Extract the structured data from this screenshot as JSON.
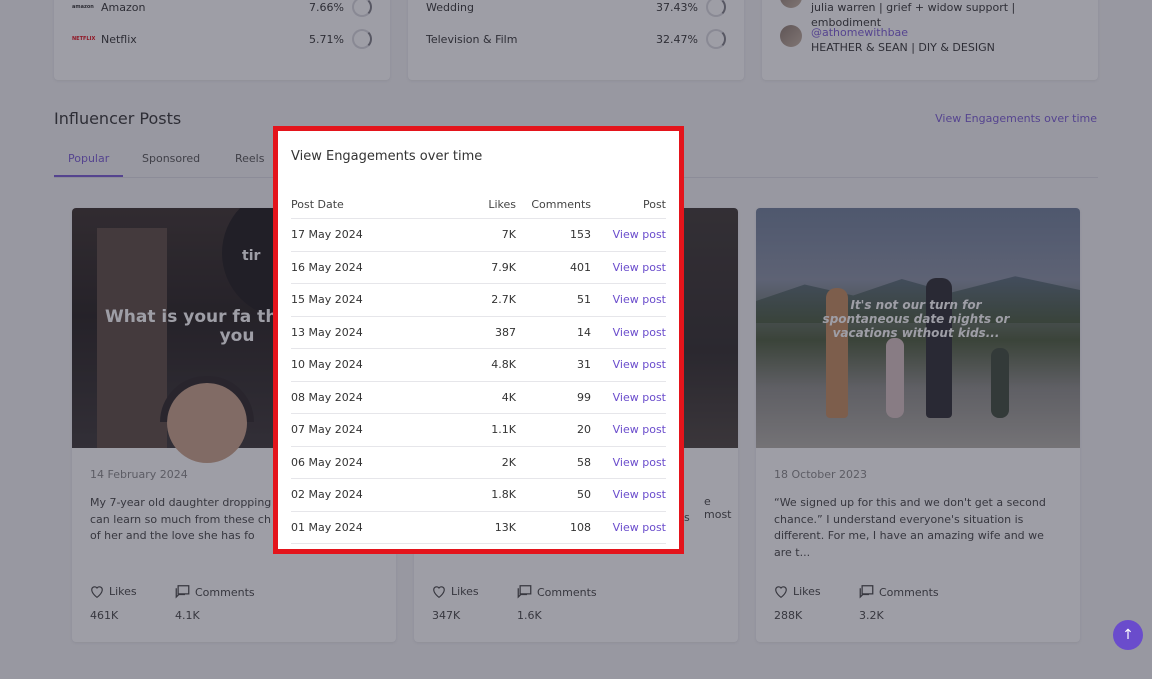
{
  "stats": {
    "platforms": [
      {
        "label": "Amazon",
        "logo": "amazon",
        "pct": "7.66%"
      },
      {
        "label": "Netflix",
        "logo": "NETFLIX",
        "pct": "5.71%"
      }
    ],
    "interests": [
      {
        "label": "Wedding",
        "pct": "37.43%"
      },
      {
        "label": "Television & Film",
        "pct": "32.47%"
      }
    ],
    "influencers": {
      "first_bio": "julia warren | grief + widow support | embodiment",
      "second_handle": "@athomewithbae",
      "second_bio": "HEATHER & SEAN | DIY & DESIGN"
    }
  },
  "section": {
    "title": "Influencer Posts",
    "link": "View Engagements over time"
  },
  "tabs": [
    {
      "label": "Popular"
    },
    {
      "label": "Sponsored"
    },
    {
      "label": "Reels"
    }
  ],
  "posts": [
    {
      "image_text": "What is your fa thing about you",
      "image_label": "tir",
      "date": "14 February 2024",
      "desc": "My 7-year old daughter dropping so We can learn so much from these ch proud of her and the love she has fo",
      "likes_label": "Likes",
      "likes": "461K",
      "comments_label": "Comments",
      "comments": "4.1K"
    },
    {
      "date": "",
      "desc_right_1": "e most",
      "desc_right_2": "s",
      "likes_label": "Likes",
      "likes": "347K",
      "comments_label": "Comments",
      "comments": "1.6K"
    },
    {
      "image_text": "It's not our turn for spontaneous date nights or vacations without kids...",
      "date": "18 October 2023",
      "desc": "“We signed up for this and we don't get a second chance.” I understand everyone's situation is different. For me, I have an amazing wife and we are t...",
      "likes_label": "Likes",
      "likes": "288K",
      "comments_label": "Comments",
      "comments": "3.2K"
    }
  ],
  "modal": {
    "title": "View Engagements over time",
    "columns": {
      "date": "Post Date",
      "likes": "Likes",
      "comments": "Comments",
      "post": "Post"
    },
    "rows": [
      {
        "date": "17 May 2024",
        "likes": "7K",
        "comments": "153",
        "link": "View post"
      },
      {
        "date": "16 May 2024",
        "likes": "7.9K",
        "comments": "401",
        "link": "View post"
      },
      {
        "date": "15 May 2024",
        "likes": "2.7K",
        "comments": "51",
        "link": "View post"
      },
      {
        "date": "13 May 2024",
        "likes": "387",
        "comments": "14",
        "link": "View post"
      },
      {
        "date": "10 May 2024",
        "likes": "4.8K",
        "comments": "31",
        "link": "View post"
      },
      {
        "date": "08 May 2024",
        "likes": "4K",
        "comments": "99",
        "link": "View post"
      },
      {
        "date": "07 May 2024",
        "likes": "1.1K",
        "comments": "20",
        "link": "View post"
      },
      {
        "date": "06 May 2024",
        "likes": "2K",
        "comments": "58",
        "link": "View post"
      },
      {
        "date": "02 May 2024",
        "likes": "1.8K",
        "comments": "50",
        "link": "View post"
      },
      {
        "date": "01 May 2024",
        "likes": "13K",
        "comments": "108",
        "link": "View post"
      }
    ]
  },
  "scroll_top_icon": "arrow-up-icon",
  "colors": {
    "accent": "#7b5cd6",
    "highlight_border": "#e4141b"
  }
}
